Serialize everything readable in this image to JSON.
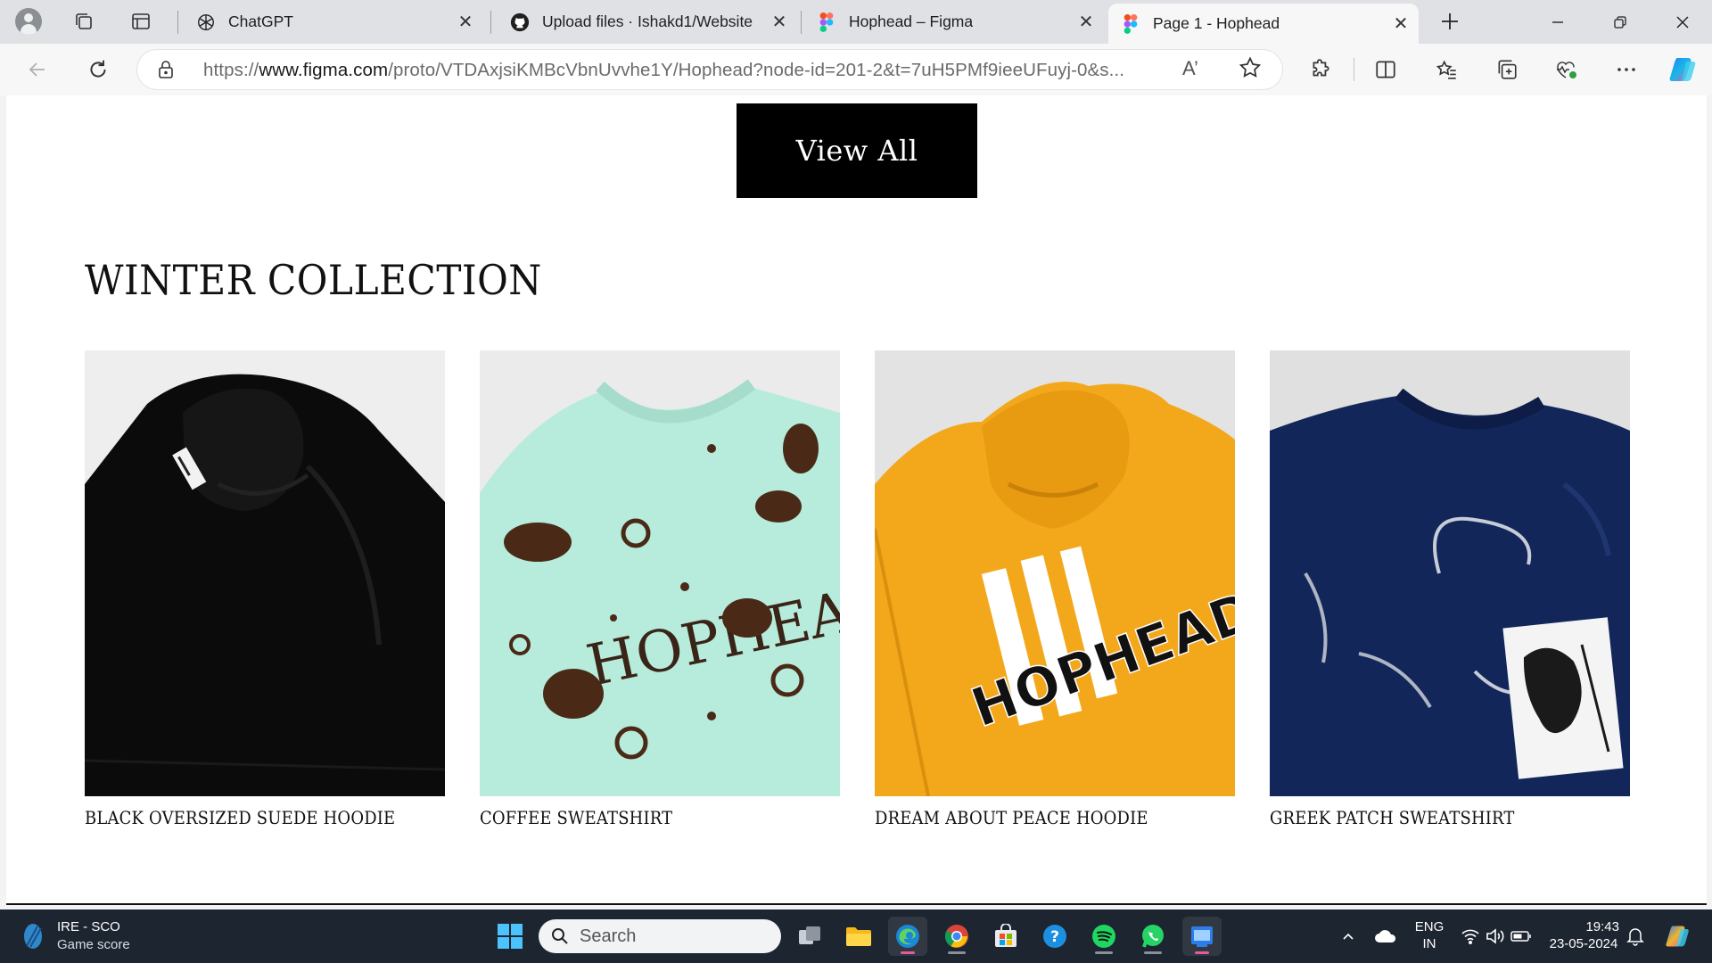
{
  "browser": {
    "tabs": [
      {
        "title": "ChatGPT",
        "favicon": "chatgpt-icon",
        "active": false
      },
      {
        "title": "Upload files · Ishakd1/Website",
        "favicon": "github-icon",
        "active": false
      },
      {
        "title": "Hophead – Figma",
        "favicon": "figma-icon",
        "active": false
      },
      {
        "title": "Page 1 - Hophead",
        "favicon": "figma-icon",
        "active": true
      }
    ],
    "url_prefix": "https://",
    "url_host": "www.figma.com",
    "url_path": "/proto/VTDAxjsiKMBcVbnUvvhe1Y/Hophead?node-id=201-2&t=7uH5PMf9ieeUFuyj-0&s...",
    "read_aloud_glyph": "A’"
  },
  "page": {
    "view_all_label": "View All",
    "section_title": "WINTER COLLECTION",
    "products": [
      {
        "name": "BLACK OVERSIZED SUEDE HOODIE",
        "color": "#0b0b0b"
      },
      {
        "name": "COFFEE SWEATSHIRT",
        "color": "#b7ecdc"
      },
      {
        "name": "DREAM ABOUT PEACE HOODIE",
        "color": "#f3a81c"
      },
      {
        "name": "GREEK PATCH SWEATSHIRT",
        "color": "#13265a"
      }
    ],
    "print_text": "HOPHEAD"
  },
  "taskbar": {
    "weather_line1": "IRE - SCO",
    "weather_line2": "Game score",
    "search_label": "Search",
    "lang_line1": "ENG",
    "lang_line2": "IN",
    "time": "19:43",
    "date": "23-05-2024"
  },
  "colors": {
    "tabstrip_bg": "#dfe1e5",
    "page_bg": "#ffffff",
    "button_bg": "#000000",
    "taskbar_bg": "#1d2530"
  }
}
